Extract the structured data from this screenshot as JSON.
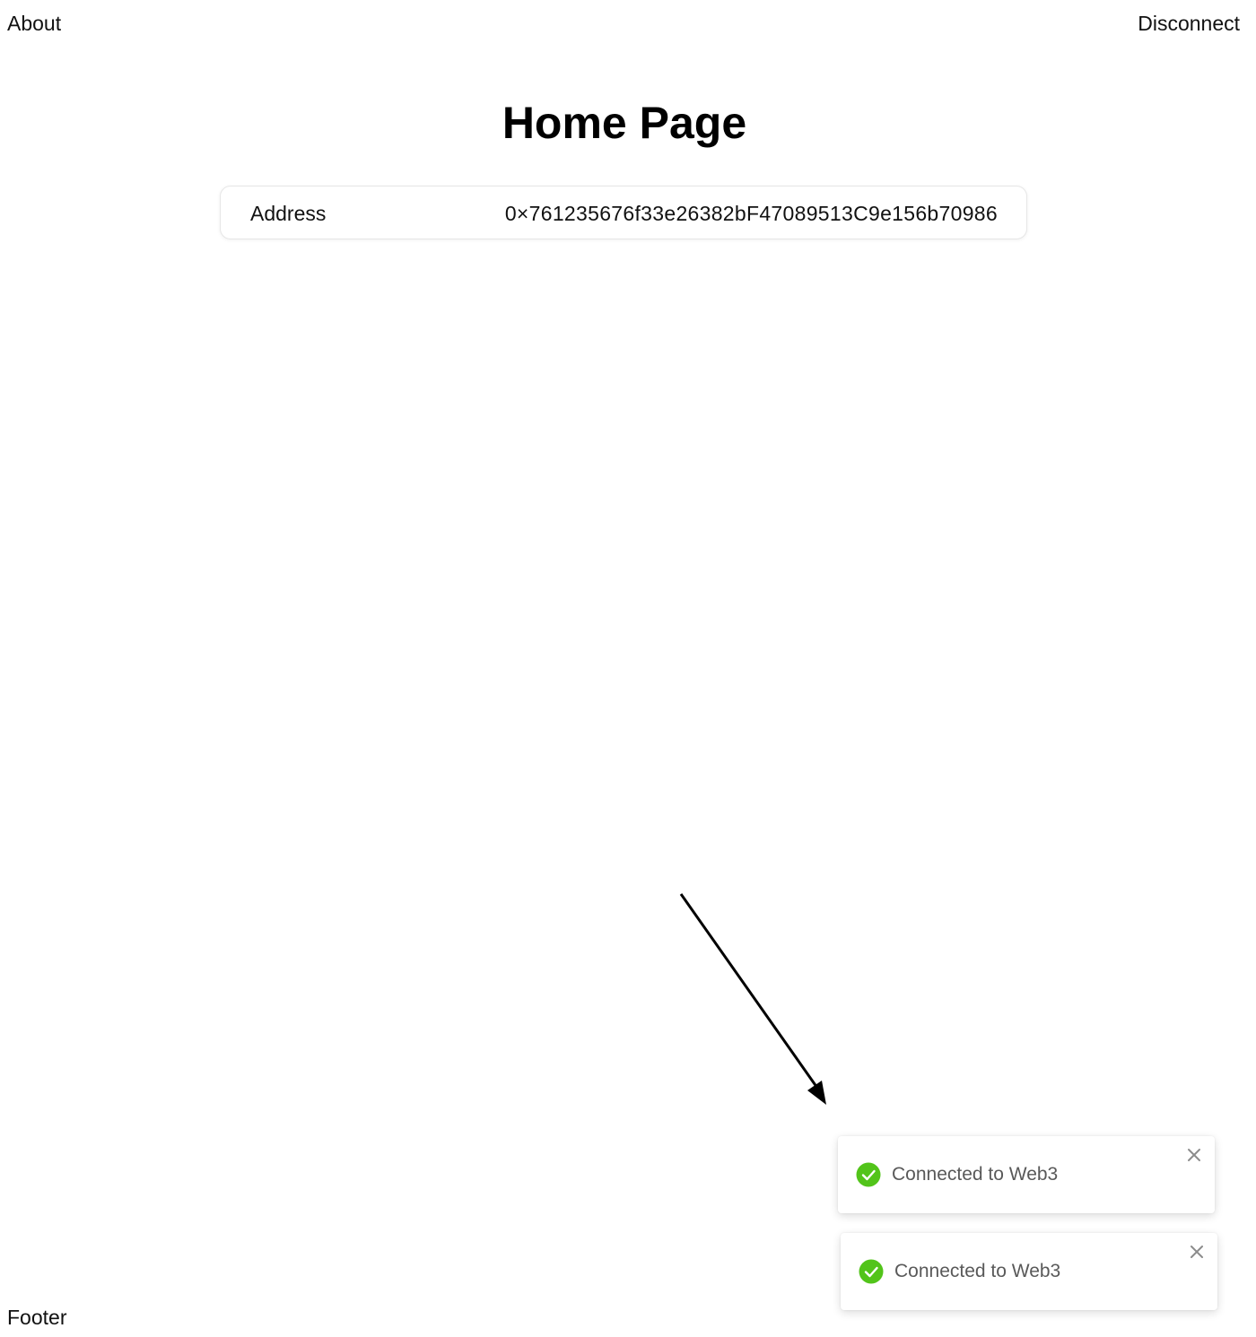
{
  "header": {
    "about_label": "About",
    "disconnect_label": "Disconnect"
  },
  "main": {
    "title": "Home Page",
    "address_card": {
      "label": "Address",
      "value": "0×761235676f33e26382bF47089513C9e156b70986"
    }
  },
  "notifications": [
    {
      "message": "Connected to Web3",
      "status": "success",
      "icon": "check-circle-icon",
      "close_icon": "close-icon"
    },
    {
      "message": "Connected to Web3",
      "status": "success",
      "icon": "check-circle-icon",
      "close_icon": "close-icon"
    }
  ],
  "footer": {
    "text": "Footer"
  },
  "colors": {
    "success": "#52c41a",
    "text": "#111111",
    "toast_text": "#595959",
    "close_icon": "#8c8c8c",
    "card_border": "#e6e6e6"
  },
  "annotation": {
    "icon": "arrow-icon",
    "color": "#000000"
  }
}
